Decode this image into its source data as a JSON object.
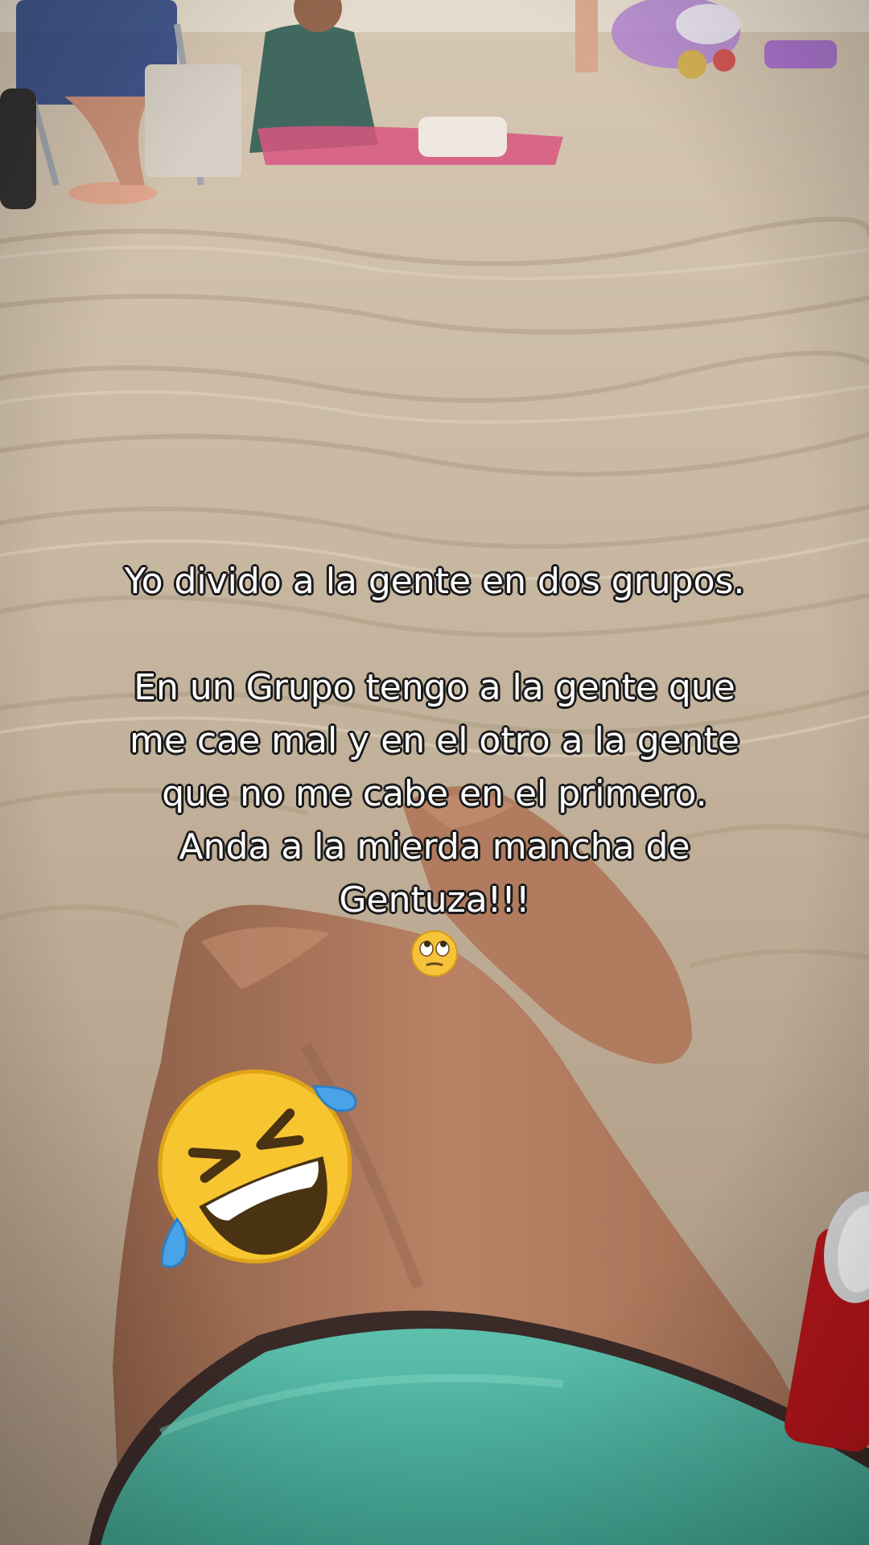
{
  "caption": {
    "line1": "Yo divido a la gente en dos grupos.",
    "line2": "En un Grupo tengo a la gente que",
    "line3": "me cae mal y en el otro a la gente",
    "line4": "que no me cabe en el primero.",
    "line5": "Anda a la mierda mancha de",
    "line6": "Gentuza!!!"
  },
  "stickers": {
    "small_emoji": "face-with-rolling-eyes-icon",
    "large_emoji": "rolling-on-the-floor-laughing-icon"
  },
  "colors": {
    "caption_text": "#ffffff",
    "caption_outline": "#1a1a1a",
    "sand": "#c2b29c",
    "shorts": "#4fb3a0",
    "skin": "#b07a5c"
  }
}
